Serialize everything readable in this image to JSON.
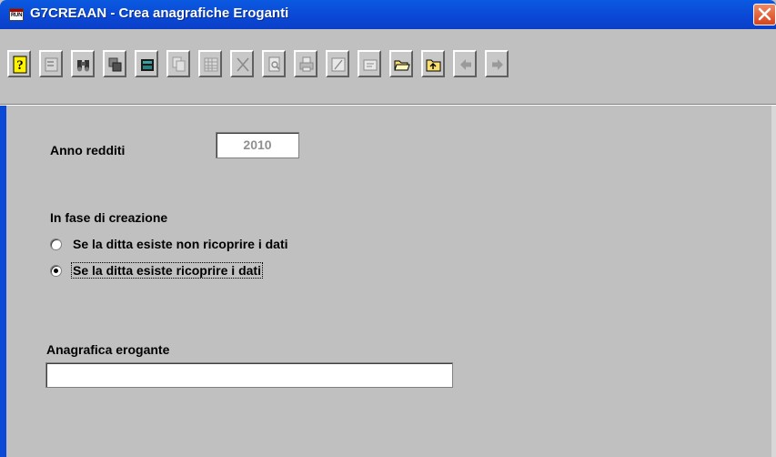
{
  "window": {
    "title": "G7CREAAN - Crea anagrafiche Eroganti",
    "icon_text": "RUN",
    "close_icon": "close-icon"
  },
  "toolbar": {
    "buttons": [
      {
        "name": "help",
        "icon": "question-mark-icon",
        "enabled": true
      },
      {
        "name": "properties",
        "icon": "properties-icon",
        "enabled": false
      },
      {
        "name": "search",
        "icon": "binoculars-icon",
        "enabled": true
      },
      {
        "name": "copy-window",
        "icon": "window-stack-icon",
        "enabled": true
      },
      {
        "name": "calculator",
        "icon": "calculator-icon",
        "enabled": true
      },
      {
        "name": "duplicate",
        "icon": "copy-icon",
        "enabled": false
      },
      {
        "name": "grid",
        "icon": "grid-icon",
        "enabled": false
      },
      {
        "name": "delete",
        "icon": "x-icon",
        "enabled": false
      },
      {
        "name": "preview",
        "icon": "print-preview-icon",
        "enabled": false
      },
      {
        "name": "print",
        "icon": "printer-icon",
        "enabled": false
      },
      {
        "name": "edit",
        "icon": "edit-icon",
        "enabled": false
      },
      {
        "name": "note",
        "icon": "note-icon",
        "enabled": false
      },
      {
        "name": "open",
        "icon": "folder-open-icon",
        "enabled": true
      },
      {
        "name": "up-folder",
        "icon": "folder-up-icon",
        "enabled": true
      },
      {
        "name": "previous",
        "icon": "arrow-left-icon",
        "enabled": false
      },
      {
        "name": "next",
        "icon": "arrow-right-icon",
        "enabled": false
      }
    ]
  },
  "form": {
    "anno_label": "Anno redditi",
    "anno_value": "2010",
    "creation_label": "In fase di creazione",
    "radio_options": [
      {
        "label": "Se la ditta esiste non ricoprire i dati",
        "checked": false
      },
      {
        "label": "Se la ditta esiste ricoprire i dati",
        "checked": true
      }
    ],
    "anagrafica_label": "Anagrafica erogante",
    "anagrafica_value": ""
  }
}
